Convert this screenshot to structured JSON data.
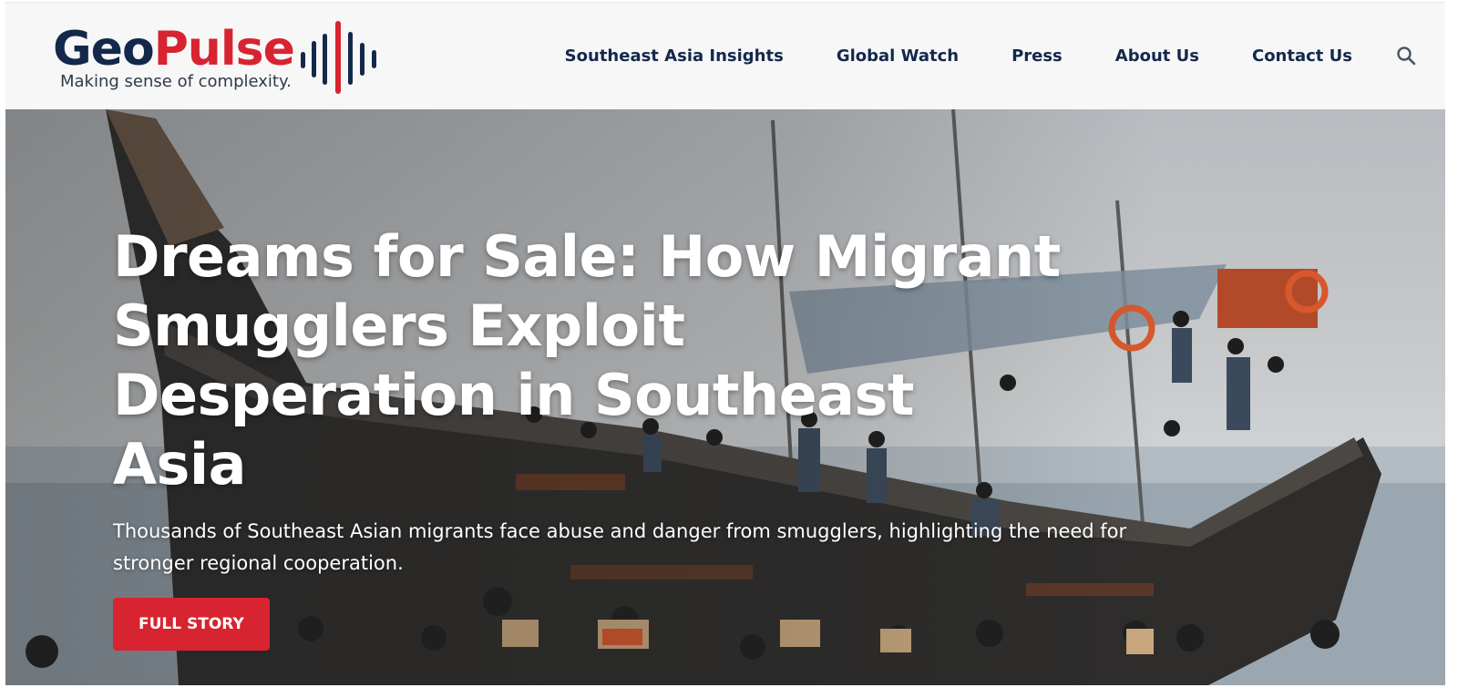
{
  "brand": {
    "name_part1": "Geo",
    "name_part2": "Pulse",
    "tagline": "Making sense of complexity.",
    "colors": {
      "navy": "#13284b",
      "red": "#d82330"
    }
  },
  "nav": {
    "items": [
      {
        "label": "Southeast Asia Insights"
      },
      {
        "label": "Global Watch"
      },
      {
        "label": "Press"
      },
      {
        "label": "About Us"
      },
      {
        "label": "Contact Us"
      }
    ],
    "search_icon": "search-icon"
  },
  "hero": {
    "title": "Dreams for Sale: How Migrant Smugglers Exploit Desperation in Southeast Asia",
    "summary": "Thousands of Southeast Asian migrants face abuse and danger from smugglers, highlighting the need for stronger regional cooperation.",
    "cta_label": "FULL STORY",
    "cta_color": "#d82330",
    "image_subject": "wooden-boat-with-migrants"
  }
}
